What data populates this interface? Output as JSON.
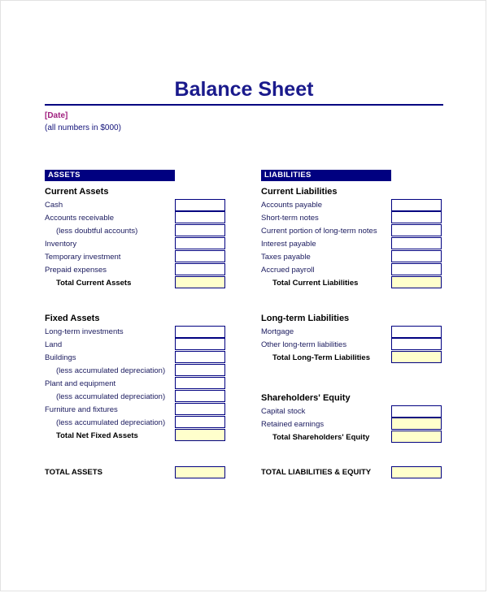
{
  "document": {
    "title": "Balance Sheet",
    "date_placeholder": "[Date]",
    "units_note": "(all numbers in $000)"
  },
  "colors": {
    "navy": "#000080",
    "title_blue": "#1a1a8c",
    "date_magenta": "#a0207f",
    "total_fill": "#ffffcc"
  },
  "assets": {
    "header": "ASSETS",
    "current": {
      "heading": "Current Assets",
      "rows": [
        {
          "label": "Cash",
          "value": "",
          "style": "normal",
          "fill": false
        },
        {
          "label": "Accounts receivable",
          "value": "",
          "style": "normal",
          "fill": false
        },
        {
          "label": "(less doubtful accounts)",
          "value": "",
          "style": "indent",
          "fill": false
        },
        {
          "label": "Inventory",
          "value": "",
          "style": "normal",
          "fill": false
        },
        {
          "label": "Temporary investment",
          "value": "",
          "style": "normal",
          "fill": false
        },
        {
          "label": "Prepaid expenses",
          "value": "",
          "style": "normal",
          "fill": false
        },
        {
          "label": "Total Current Assets",
          "value": "",
          "style": "total",
          "fill": true
        }
      ]
    },
    "fixed": {
      "heading": "Fixed Assets",
      "rows": [
        {
          "label": "Long-term investments",
          "value": "",
          "style": "normal",
          "fill": false
        },
        {
          "label": "Land",
          "value": "",
          "style": "normal",
          "fill": false
        },
        {
          "label": "Buildings",
          "value": "",
          "style": "normal",
          "fill": false
        },
        {
          "label": "(less accumulated depreciation)",
          "value": "",
          "style": "indent",
          "fill": false
        },
        {
          "label": "Plant and equipment",
          "value": "",
          "style": "normal",
          "fill": false
        },
        {
          "label": "(less accumulated depreciation)",
          "value": "",
          "style": "indent",
          "fill": false
        },
        {
          "label": "Furniture and fixtures",
          "value": "",
          "style": "normal",
          "fill": false
        },
        {
          "label": "(less accumulated depreciation)",
          "value": "",
          "style": "indent",
          "fill": false
        },
        {
          "label": "Total Net Fixed Assets",
          "value": "",
          "style": "total",
          "fill": true
        }
      ]
    },
    "grand_total": {
      "label": "TOTAL ASSETS",
      "value": ""
    }
  },
  "liabilities": {
    "header": "LIABILITIES",
    "current": {
      "heading": "Current Liabilities",
      "rows": [
        {
          "label": "Accounts payable",
          "value": "",
          "style": "normal",
          "fill": false
        },
        {
          "label": "Short-term notes",
          "value": "",
          "style": "normal",
          "fill": false
        },
        {
          "label": "Current portion of long-term notes",
          "value": "",
          "style": "normal",
          "fill": false
        },
        {
          "label": "Interest payable",
          "value": "",
          "style": "normal",
          "fill": false
        },
        {
          "label": "Taxes payable",
          "value": "",
          "style": "normal",
          "fill": false
        },
        {
          "label": "Accrued payroll",
          "value": "",
          "style": "normal",
          "fill": false
        },
        {
          "label": "Total Current Liabilities",
          "value": "",
          "style": "total",
          "fill": true
        }
      ]
    },
    "longterm": {
      "heading": "Long-term Liabilities",
      "rows": [
        {
          "label": "Mortgage",
          "value": "",
          "style": "normal",
          "fill": false
        },
        {
          "label": "Other long-term liabilities",
          "value": "",
          "style": "normal",
          "fill": false
        },
        {
          "label": "Total Long-Term Liabilities",
          "value": "",
          "style": "total",
          "fill": true
        }
      ]
    },
    "equity": {
      "heading": "Shareholders' Equity",
      "rows": [
        {
          "label": "Capital stock",
          "value": "",
          "style": "normal",
          "fill": false
        },
        {
          "label": "Retained earnings",
          "value": "",
          "style": "normal",
          "fill": true
        },
        {
          "label": "Total Shareholders' Equity",
          "value": "",
          "style": "total",
          "fill": true
        }
      ]
    },
    "grand_total": {
      "label": "TOTAL LIABILITIES & EQUITY",
      "value": ""
    }
  }
}
